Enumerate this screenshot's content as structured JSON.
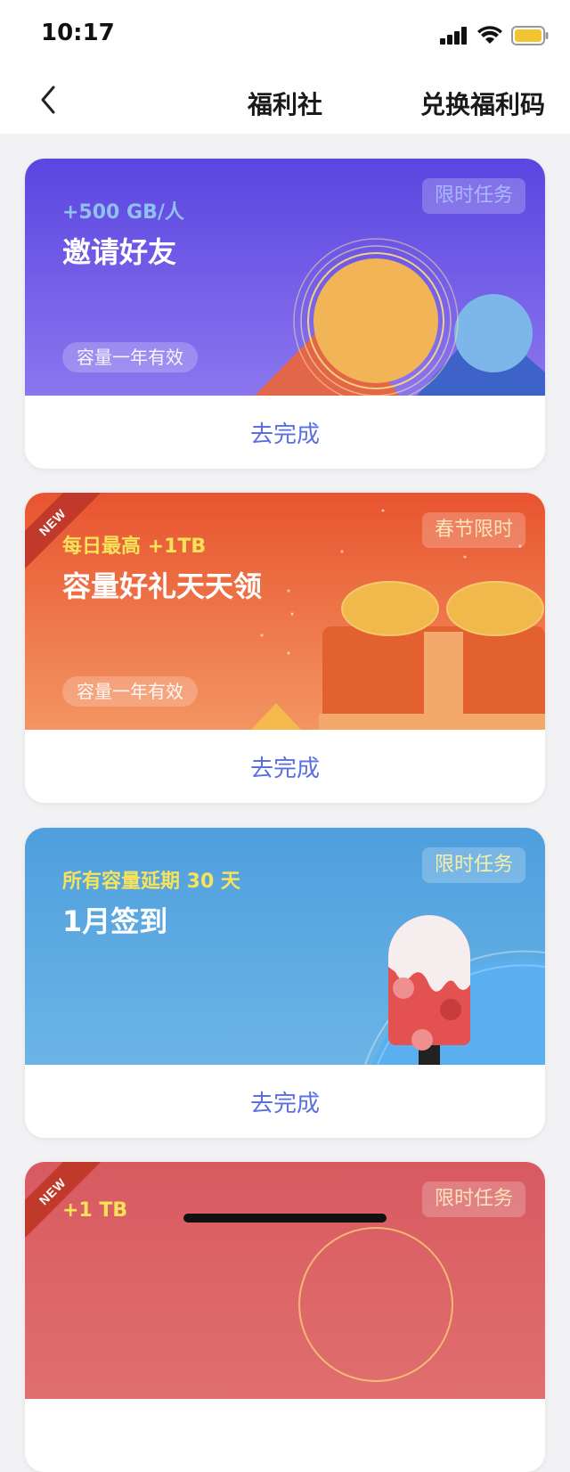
{
  "status": {
    "time": "10:17"
  },
  "nav": {
    "title": "福利社",
    "right_action": "兑换福利码"
  },
  "colors": {
    "link_blue": "#5a6fe0",
    "yellow_text": "#f7e35a"
  },
  "cards": [
    {
      "subtitle": "+500 GB/人",
      "title": "邀请好友",
      "tag": "限时任务",
      "pill": "容量一年有效",
      "action": "去完成",
      "theme": "purple"
    },
    {
      "badge": "NEW",
      "subtitle": "每日最高 +1TB",
      "title": "容量好礼天天领",
      "tag": "春节限时",
      "pill": "容量一年有效",
      "action": "去完成",
      "theme": "orange"
    },
    {
      "subtitle": "所有容量延期 30 天",
      "title": "1月签到",
      "tag": "限时任务",
      "action": "去完成",
      "theme": "blue"
    },
    {
      "badge": "NEW",
      "subtitle": "+1 TB",
      "tag": "限时任务",
      "theme": "red"
    }
  ]
}
